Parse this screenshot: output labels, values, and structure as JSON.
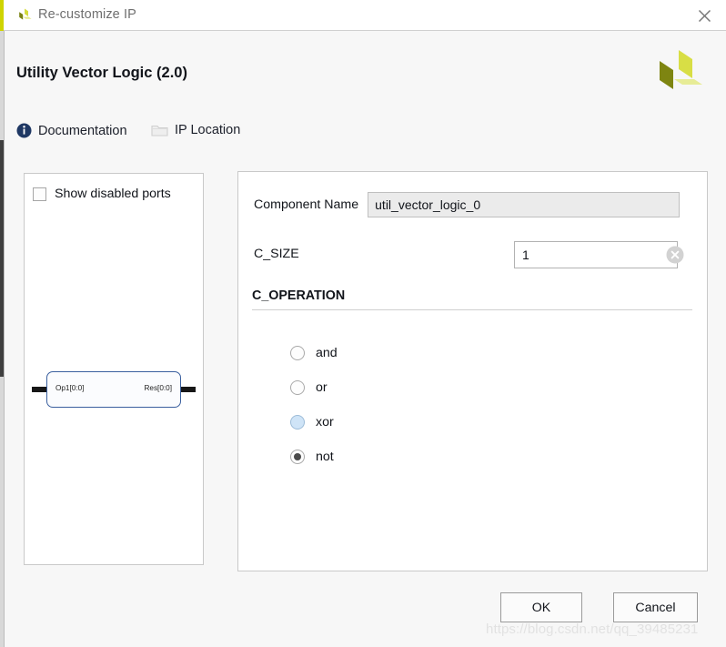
{
  "window": {
    "title": "Re-customize IP",
    "app_icon": "xilinx-pinwheel-icon",
    "close_icon": "close-icon"
  },
  "header": {
    "ip_title": "Utility Vector Logic (2.0)",
    "logo_icon": "xilinx-logo",
    "links": [
      {
        "label": "Documentation",
        "icon": "info-icon"
      },
      {
        "label": "IP Location",
        "icon": "folder-icon"
      }
    ]
  },
  "left_panel": {
    "show_disabled_ports": {
      "label": "Show disabled ports",
      "checked": false
    },
    "symbol": {
      "input_port": "Op1[0:0]",
      "output_port": "Res[0:0]"
    }
  },
  "right_panel": {
    "component_name": {
      "label": "Component Name",
      "value": "util_vector_logic_0"
    },
    "c_size": {
      "label": "C_SIZE",
      "value": "1",
      "clear_icon": "clear-circle-icon"
    },
    "c_operation": {
      "title": "C_OPERATION",
      "options": [
        {
          "label": "and",
          "state": "normal"
        },
        {
          "label": "or",
          "state": "normal"
        },
        {
          "label": "xor",
          "state": "hover"
        },
        {
          "label": "not",
          "state": "checked"
        }
      ]
    }
  },
  "footer": {
    "ok_label": "OK",
    "cancel_label": "Cancel"
  },
  "watermark": {
    "text": "https://blog.csdn.net/qq_39485231"
  },
  "colors": {
    "xilinx_accent": "#cfd400",
    "radio_hover": "#cfe4f7",
    "panel_border": "#c9c9c9",
    "title_text": "#6f6f6f"
  }
}
